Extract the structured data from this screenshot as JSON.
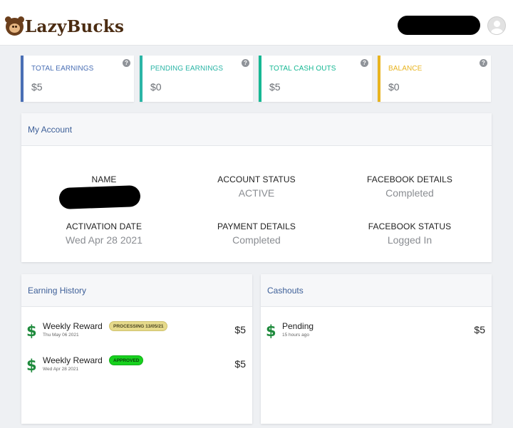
{
  "header": {
    "brand_name": "LazyBucks",
    "logo_icon": "bear-logo-icon",
    "user_avatar_icon": "user-avatar-icon"
  },
  "stats": [
    {
      "label": "TOTAL EARNINGS",
      "value": "$5",
      "color": "#4a6fb5",
      "help": "?"
    },
    {
      "label": "PENDING EARNINGS",
      "value": "$0",
      "color": "#2bb5a6",
      "help": "?"
    },
    {
      "label": "TOTAL CASH OUTS",
      "value": "$5",
      "color": "#16b894",
      "help": "?"
    },
    {
      "label": "BALANCE",
      "value": "$0",
      "color": "#e8b420",
      "help": "?"
    }
  ],
  "account": {
    "title": "My Account",
    "name_label": "NAME",
    "account_status_label": "ACCOUNT STATUS",
    "account_status_value": "ACTIVE",
    "facebook_details_label": "FACEBOOK DETAILS",
    "facebook_details_value": "Completed",
    "activation_date_label": "ACTIVATION DATE",
    "activation_date_value": "Wed Apr 28 2021",
    "payment_details_label": "PAYMENT DETAILS",
    "payment_details_value": "Completed",
    "facebook_status_label": "FACEBOOK STATUS",
    "facebook_status_value": "Logged In"
  },
  "earning_history": {
    "title": "Earning History",
    "rows": [
      {
        "title": "Weekly Reward",
        "date": "Thu May 06 2021",
        "badge": "PROCESSING 13/05/21",
        "badge_type": "processing",
        "amount": "$5"
      },
      {
        "title": "Weekly Reward",
        "date": "Wed Apr 28 2021",
        "badge": "APPROVED",
        "badge_type": "approved",
        "amount": "$5"
      }
    ]
  },
  "cashouts": {
    "title": "Cashouts",
    "rows": [
      {
        "title": "Pending",
        "date": "15 hours ago",
        "amount": "$5"
      }
    ]
  },
  "colors": {
    "brand": "#4b2c12",
    "link_title": "#3d5f98",
    "dollar_green": "#1e8a3c"
  }
}
